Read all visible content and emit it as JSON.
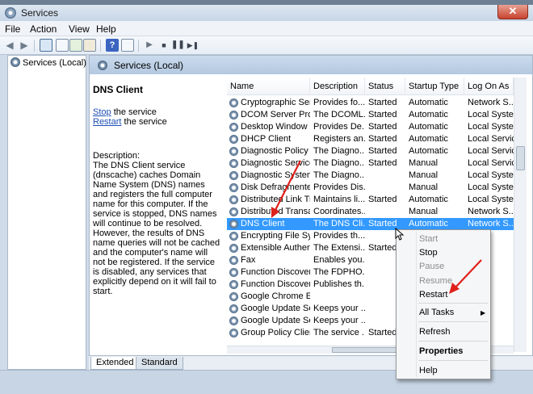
{
  "window": {
    "title": "Services"
  },
  "menubar": {
    "items": [
      "File",
      "Action",
      "View",
      "Help"
    ]
  },
  "toolbar": {
    "help_label": "?"
  },
  "tree": {
    "root_label": "Services (Local)"
  },
  "main": {
    "header_title": "Services (Local)",
    "selected_service_name": "DNS Client",
    "stop_link": "Stop",
    "stop_suffix": " the service",
    "restart_link": "Restart",
    "restart_suffix": " the service",
    "description_label": "Description:",
    "description_text": "The DNS Client service (dnscache) caches Domain Name System (DNS) names and registers the full computer name for this computer. If the service is stopped, DNS names will continue to be resolved. However, the results of DNS name queries will not be cached and the computer's name will not be registered. If the service is disabled, any services that explicitly depend on it will fail to start."
  },
  "list": {
    "columns": [
      "Name",
      "Description",
      "Status",
      "Startup Type",
      "Log On As"
    ],
    "rows": [
      {
        "name": "Cryptographic Ser...",
        "description": "Provides fo...",
        "status": "Started",
        "startup": "Automatic",
        "logon": "Network S..."
      },
      {
        "name": "DCOM Server Pro...",
        "description": "The DCOML...",
        "status": "Started",
        "startup": "Automatic",
        "logon": "Local Syste..."
      },
      {
        "name": "Desktop Window ...",
        "description": "Provides De...",
        "status": "Started",
        "startup": "Automatic",
        "logon": "Local Syste..."
      },
      {
        "name": "DHCP Client",
        "description": "Registers an...",
        "status": "Started",
        "startup": "Automatic",
        "logon": "Local Service"
      },
      {
        "name": "Diagnostic Policy ...",
        "description": "The Diagno...",
        "status": "Started",
        "startup": "Automatic",
        "logon": "Local Service"
      },
      {
        "name": "Diagnostic Service...",
        "description": "The Diagno...",
        "status": "Started",
        "startup": "Manual",
        "logon": "Local Service"
      },
      {
        "name": "Diagnostic System...",
        "description": "The Diagno...",
        "status": "",
        "startup": "Manual",
        "logon": "Local Syste..."
      },
      {
        "name": "Disk Defragmenter",
        "description": "Provides Dis...",
        "status": "",
        "startup": "Manual",
        "logon": "Local Syste..."
      },
      {
        "name": "Distributed Link Tr...",
        "description": "Maintains li...",
        "status": "Started",
        "startup": "Automatic",
        "logon": "Local Syste..."
      },
      {
        "name": "Distributed Transa...",
        "description": "Coordinates...",
        "status": "",
        "startup": "Manual",
        "logon": "Network S..."
      },
      {
        "name": "DNS Client",
        "description": "The DNS Cli...",
        "status": "Started",
        "startup": "Automatic",
        "logon": "Network S..."
      },
      {
        "name": "Encrypting File Sy...",
        "description": "Provides th...",
        "status": "",
        "startup": "",
        "logon": "yste..."
      },
      {
        "name": "Extensible Authen...",
        "description": "The Extensi...",
        "status": "Started",
        "startup": "",
        "logon": "yste..."
      },
      {
        "name": "Fax",
        "description": "Enables you...",
        "status": "",
        "startup": "",
        "logon": "k S..."
      },
      {
        "name": "Function Discover...",
        "description": "The FDPHO...",
        "status": "",
        "startup": "",
        "logon": "ervice"
      },
      {
        "name": "Function Discover...",
        "description": "Publishes th...",
        "status": "",
        "startup": "",
        "logon": "ervice"
      },
      {
        "name": "Google Chrome El...",
        "description": "",
        "status": "",
        "startup": "",
        "logon": "yste..."
      },
      {
        "name": "Google Update Se...",
        "description": "Keeps your ...",
        "status": "",
        "startup": "",
        "logon": "yste..."
      },
      {
        "name": "Google Update Se...",
        "description": "Keeps your ...",
        "status": "",
        "startup": "",
        "logon": "yste..."
      },
      {
        "name": "Group Policy Client",
        "description": "The service ...",
        "status": "Started",
        "startup": "",
        "logon": "yste..."
      }
    ]
  },
  "tabs": [
    "Extended",
    "Standard"
  ],
  "context_menu": {
    "items": [
      {
        "label": "Start",
        "state": "disabled"
      },
      {
        "label": "Stop",
        "state": "enabled"
      },
      {
        "label": "Pause",
        "state": "disabled"
      },
      {
        "label": "Resume",
        "state": "disabled"
      },
      {
        "label": "Restart",
        "state": "enabled"
      },
      {
        "label": "All Tasks",
        "state": "submenu"
      },
      {
        "label": "Refresh",
        "state": "enabled"
      },
      {
        "label": "Properties",
        "state": "bold"
      },
      {
        "label": "Help",
        "state": "enabled"
      }
    ]
  },
  "colors": {
    "selection": "#3399ff",
    "annotation_arrow": "#e0201b",
    "link": "#1d4fb5"
  }
}
